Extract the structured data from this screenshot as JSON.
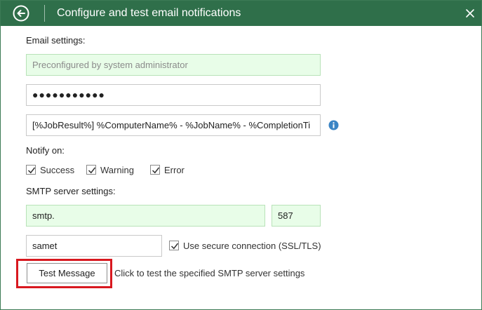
{
  "titlebar": {
    "title": "Configure and test email notifications",
    "back_icon": "back-arrow-circle-icon",
    "close_icon": "close-icon",
    "color": "#2f6f4a"
  },
  "email_settings": {
    "label": "Email settings:",
    "sender_placeholder": "Preconfigured by system administrator",
    "password_mask": "●●●●●●●●●●●",
    "subject": "[%JobResult%] %ComputerName% - %JobName% - %CompletionTi",
    "info_icon": "info-icon"
  },
  "notify_on": {
    "label": "Notify on:",
    "options": [
      {
        "label": "Success",
        "checked": true
      },
      {
        "label": "Warning",
        "checked": true
      },
      {
        "label": "Error",
        "checked": true
      }
    ]
  },
  "smtp": {
    "label": "SMTP server settings:",
    "server": "smtp.",
    "port": "587",
    "username": "samet",
    "secure_label": "Use secure connection (SSL/TLS)",
    "secure_checked": true
  },
  "test": {
    "button_label": "Test Message",
    "hint": "Click to test the specified SMTP server settings",
    "highlight_color": "#d8181f"
  },
  "colors": {
    "field_green_bg": "#e8fde8",
    "info_blue": "#3a84c4"
  }
}
